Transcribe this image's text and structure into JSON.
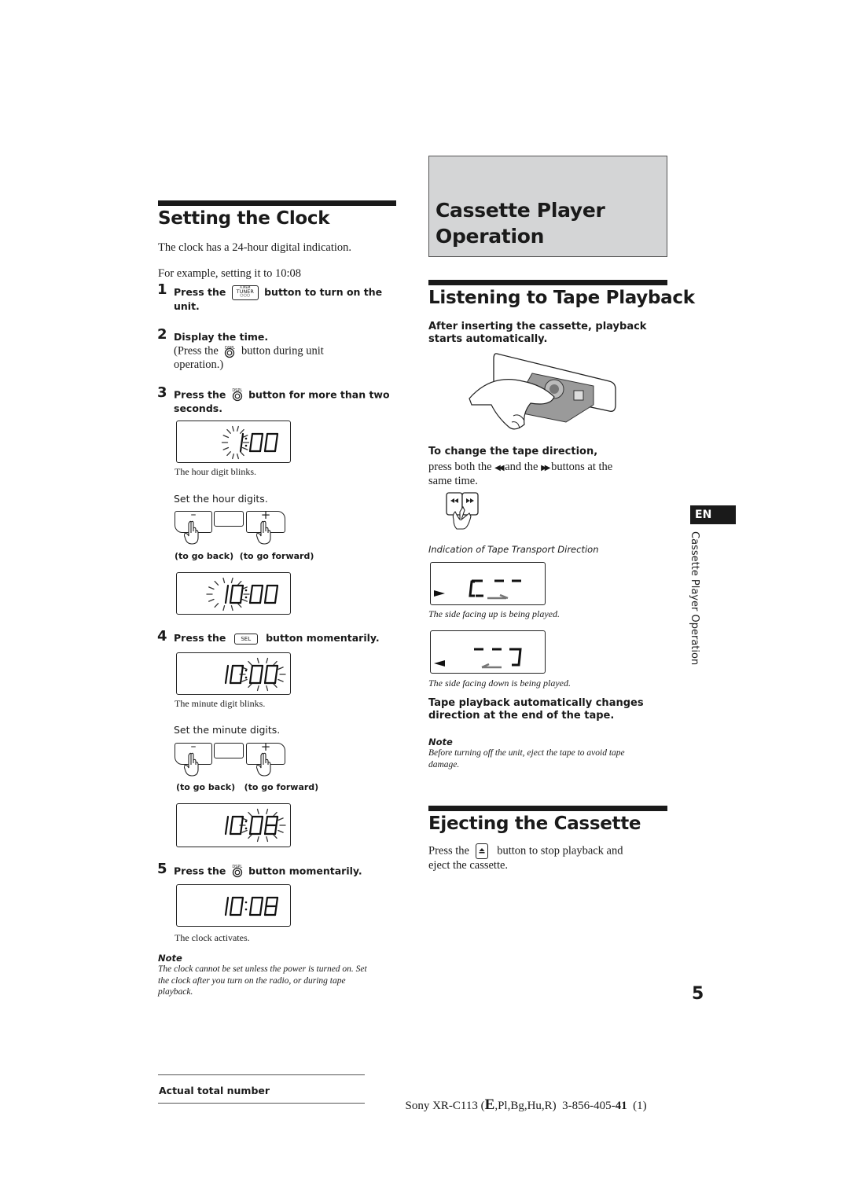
{
  "left": {
    "title": "Setting the Clock",
    "intro": "The clock has a 24-hour digital indication.",
    "example": "For example, setting it to 10:08",
    "steps": [
      {
        "num": "1",
        "pre": "Press the",
        "post": "button to turn on the",
        "cont": "unit.",
        "button": {
          "top": "A.MEM",
          "label": "TUNER"
        }
      },
      {
        "num": "2",
        "text": "Display the time.",
        "sub_pre": "(Press the",
        "sub_post": "button during  unit",
        "sub_cont": "operation.)",
        "button_label": "DSPL"
      },
      {
        "num": "3",
        "pre": "Press the",
        "post": "button for more than two",
        "cont": "seconds.",
        "button_label": "DSPL"
      },
      {
        "num": "4",
        "pre": "Press the",
        "post": "button momentarily.",
        "button_label": "SEL"
      },
      {
        "num": "5",
        "pre": "Press the",
        "post": "button momentarily.",
        "button_label": "DSPL"
      }
    ],
    "lcd1": {
      "digits": "1:00",
      "blink": "hour",
      "caption": "The hour digit blinks."
    },
    "set_hour": "Set the hour digits.",
    "back_label": "(to go back)",
    "forward_label": "(to go forward)",
    "minus": "–",
    "plus": "+",
    "lcd2": {
      "digits": "10:00",
      "blink": "hour"
    },
    "lcd3": {
      "digits": "10:00",
      "blink": "minute",
      "caption": "The minute digit blinks."
    },
    "set_minute": "Set the minute digits.",
    "lcd4": {
      "digits": "10:08",
      "blink": "minute"
    },
    "lcd5": {
      "digits": "10:08",
      "caption": "The clock activates."
    },
    "note_heading": "Note",
    "note_lines": [
      "The clock cannot be set unless the power is turned on. Set",
      "the clock after you turn on the radio, or during tape",
      "playback."
    ]
  },
  "right": {
    "chapter_title_line1": "Cassette Player",
    "chapter_title_line2": "Operation",
    "section1_title": "Listening to Tape Playback",
    "section1_lead_line1": "After inserting the cassette, playback",
    "section1_lead_line2": "starts automatically.",
    "change_dir_heading": "To change the tape direction,",
    "change_dir_line1_pre": "press both the",
    "change_dir_line1_mid": "and the",
    "change_dir_line1_post": "buttons at the",
    "change_dir_line2": "same time.",
    "rew_glyph": "◀◀",
    "ff_glyph": "▶▶",
    "indication_heading": "Indication of Tape Transport Direction",
    "side_up_caption": "The side facing up is being played.",
    "side_down_caption": "The side facing down is being played.",
    "auto_change_line1": "Tape playback automatically changes",
    "auto_change_line2": "direction at the end of the tape.",
    "note_heading": "Note",
    "note_lines": [
      "Before turning off the unit, eject the tape to avoid tape",
      "damage."
    ],
    "section2_title": "Ejecting the Cassette",
    "eject_pre": "Press the",
    "eject_post": "button to stop playback and",
    "eject_cont": "eject the cassette."
  },
  "sidebar": {
    "lang_tab": "EN",
    "running_head": "Cassette Player Operation"
  },
  "page_number": "5",
  "footer": {
    "label": "Actual total number",
    "model_pre": "Sony XR-C113 (",
    "model_e": "E",
    "model_langs": ",Pl,Bg,Hu,R)  3-856-405-",
    "model_bold": "41",
    "model_post": "  (1)"
  }
}
